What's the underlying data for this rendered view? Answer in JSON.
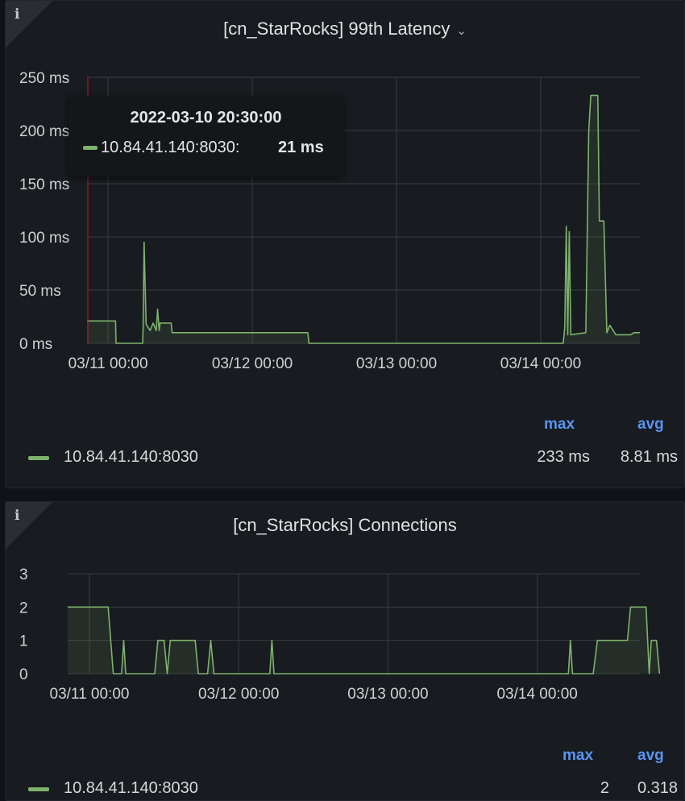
{
  "panels": [
    {
      "title": "[cn_StarRocks] 99th Latency",
      "legend": {
        "headers": {
          "max": "max",
          "avg": "avg"
        },
        "series_name": "10.84.41.140:8030",
        "max": "233 ms",
        "avg": "8.81 ms"
      },
      "tooltip": {
        "time": "2022-03-10 20:30:00",
        "series": "10.84.41.140:8030:",
        "value": "21 ms"
      }
    },
    {
      "title": "[cn_StarRocks] Connections",
      "legend": {
        "headers": {
          "max": "max",
          "avg": "avg"
        },
        "series_name": "10.84.41.140:8030",
        "max": "2",
        "avg": "0.318"
      }
    }
  ],
  "colors": {
    "series": "#7eb26d",
    "grid": "#3a3c41",
    "legend_header": "#5794f2",
    "crosshair": "#c4162a",
    "panel_bg": "#181b1f"
  },
  "icons": {
    "info": "info-icon",
    "menu": "chevron-down-icon"
  },
  "chart_data": [
    {
      "type": "area",
      "title": "[cn_StarRocks] 99th Latency",
      "x_start": "03/10 20:30",
      "x_end": "03/14 16:30",
      "x_ticks": [
        "03/11 00:00",
        "03/12 00:00",
        "03/13 00:00",
        "03/14 00:00"
      ],
      "y_ticks": [
        "0 ms",
        "50 ms",
        "100 ms",
        "150 ms",
        "200 ms",
        "250 ms"
      ],
      "ylim": [
        0,
        250
      ],
      "grid": true,
      "legend_position": "bottom",
      "series": [
        {
          "name": "10.84.41.140:8030",
          "points": [
            [
              "03/10 20:30",
              21
            ],
            [
              "03/11 01:15",
              21
            ],
            [
              "03/11 01:20",
              0
            ],
            [
              "03/11 05:45",
              0
            ],
            [
              "03/11 05:50",
              15
            ],
            [
              "03/11 06:00",
              95
            ],
            [
              "03/11 06:20",
              18
            ],
            [
              "03/11 07:00",
              12
            ],
            [
              "03/11 07:30",
              19
            ],
            [
              "03/11 08:00",
              12
            ],
            [
              "03/11 08:15",
              32
            ],
            [
              "03/11 08:30",
              12
            ],
            [
              "03/11 08:40",
              19
            ],
            [
              "03/11 10:30",
              19
            ],
            [
              "03/11 10:40",
              10
            ],
            [
              "03/12 09:15",
              10
            ],
            [
              "03/12 09:25",
              0
            ],
            [
              "03/14 03:45",
              0
            ],
            [
              "03/14 04:00",
              15
            ],
            [
              "03/14 04:15",
              110
            ],
            [
              "03/14 04:30",
              8
            ],
            [
              "03/14 04:45",
              105
            ],
            [
              "03/14 05:00",
              8
            ],
            [
              "03/14 07:30",
              10
            ],
            [
              "03/14 08:00",
              200
            ],
            [
              "03/14 08:20",
              233
            ],
            [
              "03/14 09:30",
              233
            ],
            [
              "03/14 09:45",
              115
            ],
            [
              "03/14 10:30",
              115
            ],
            [
              "03/14 11:00",
              10
            ],
            [
              "03/14 11:30",
              17
            ],
            [
              "03/14 12:30",
              8
            ],
            [
              "03/14 15:00",
              8
            ],
            [
              "03/14 15:30",
              10
            ],
            [
              "03/14 16:30",
              10
            ]
          ]
        }
      ]
    },
    {
      "type": "area",
      "title": "[cn_StarRocks] Connections",
      "x_start": "03/10 20:30",
      "x_end": "03/14 16:30",
      "x_ticks": [
        "03/11 00:00",
        "03/12 00:00",
        "03/13 00:00",
        "03/14 00:00"
      ],
      "y_ticks": [
        "0",
        "1",
        "2",
        "3"
      ],
      "ylim": [
        0,
        3
      ],
      "grid": true,
      "legend_position": "bottom",
      "series": [
        {
          "name": "10.84.41.140:8030",
          "points": [
            [
              "03/10 20:30",
              2
            ],
            [
              "03/11 03:00",
              2
            ],
            [
              "03/11 03:50",
              0
            ],
            [
              "03/11 05:10",
              0
            ],
            [
              "03/11 05:30",
              1
            ],
            [
              "03/11 05:50",
              0
            ],
            [
              "03/11 10:30",
              0
            ],
            [
              "03/11 11:00",
              1
            ],
            [
              "03/11 12:00",
              1
            ],
            [
              "03/11 12:30",
              0
            ],
            [
              "03/11 13:00",
              1
            ],
            [
              "03/11 14:30",
              1
            ],
            [
              "03/11 15:00",
              1
            ],
            [
              "03/11 17:00",
              1
            ],
            [
              "03/11 17:30",
              0
            ],
            [
              "03/11 19:00",
              0
            ],
            [
              "03/11 19:30",
              1
            ],
            [
              "03/11 20:00",
              0
            ],
            [
              "03/12 05:00",
              0
            ],
            [
              "03/12 05:20",
              1
            ],
            [
              "03/12 05:40",
              0
            ],
            [
              "03/14 05:00",
              0
            ],
            [
              "03/14 05:20",
              1
            ],
            [
              "03/14 05:40",
              0
            ],
            [
              "03/14 09:00",
              0
            ],
            [
              "03/14 09:40",
              1
            ],
            [
              "03/14 14:30",
              1
            ],
            [
              "03/14 15:00",
              2
            ],
            [
              "03/14 17:30",
              2
            ],
            [
              "03/14 18:00",
              0
            ],
            [
              "03/14 18:20",
              1
            ],
            [
              "03/14 19:10",
              1
            ],
            [
              "03/14 19:40",
              0
            ]
          ]
        }
      ]
    }
  ]
}
